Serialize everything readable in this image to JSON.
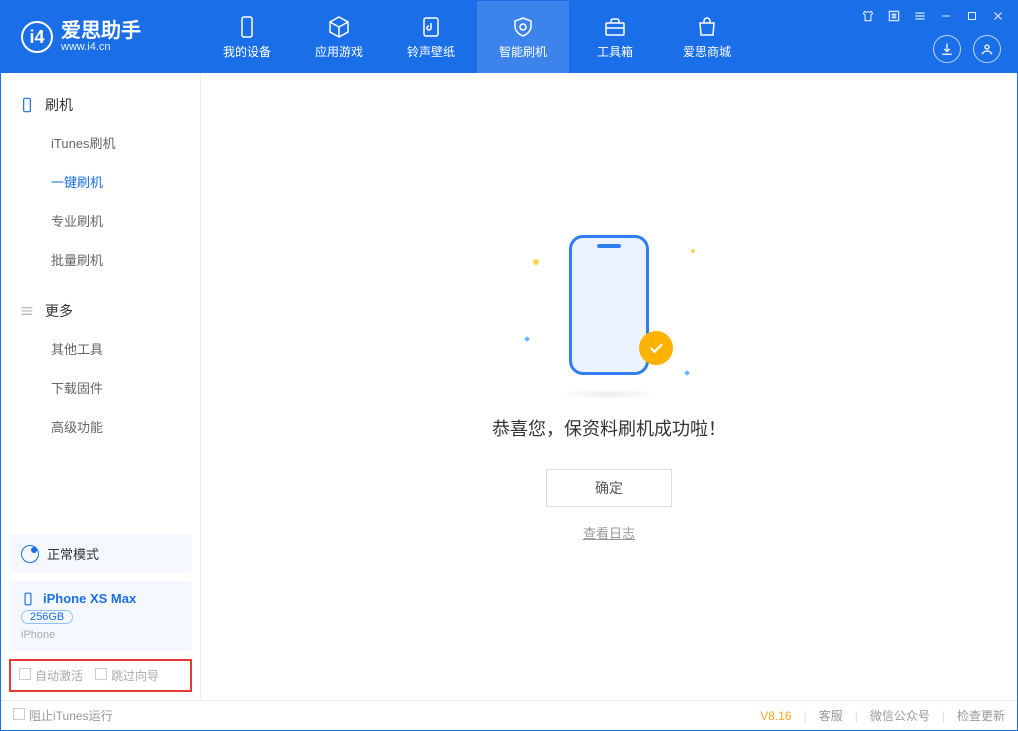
{
  "app": {
    "title": "爱思助手",
    "subtitle": "www.i4.cn"
  },
  "nav": [
    {
      "label": "我的设备"
    },
    {
      "label": "应用游戏"
    },
    {
      "label": "铃声壁纸"
    },
    {
      "label": "智能刷机"
    },
    {
      "label": "工具箱"
    },
    {
      "label": "爱思商城"
    }
  ],
  "sidebar": {
    "sectionA": {
      "title": "刷机",
      "items": [
        "iTunes刷机",
        "一键刷机",
        "专业刷机",
        "批量刷机"
      ],
      "activeIndex": 1
    },
    "sectionB": {
      "title": "更多",
      "items": [
        "其他工具",
        "下载固件",
        "高级功能"
      ]
    }
  },
  "mode": {
    "label": "正常模式"
  },
  "device": {
    "name": "iPhone XS Max",
    "capacity": "256GB",
    "type": "iPhone"
  },
  "options": {
    "a": "自动激活",
    "b": "跳过向导"
  },
  "main": {
    "success": "恭喜您，保资料刷机成功啦！",
    "ok": "确定",
    "logLink": "查看日志"
  },
  "status": {
    "left": "阻止iTunes运行",
    "version": "V8.16",
    "links": [
      "客服",
      "微信公众号",
      "检查更新"
    ]
  }
}
